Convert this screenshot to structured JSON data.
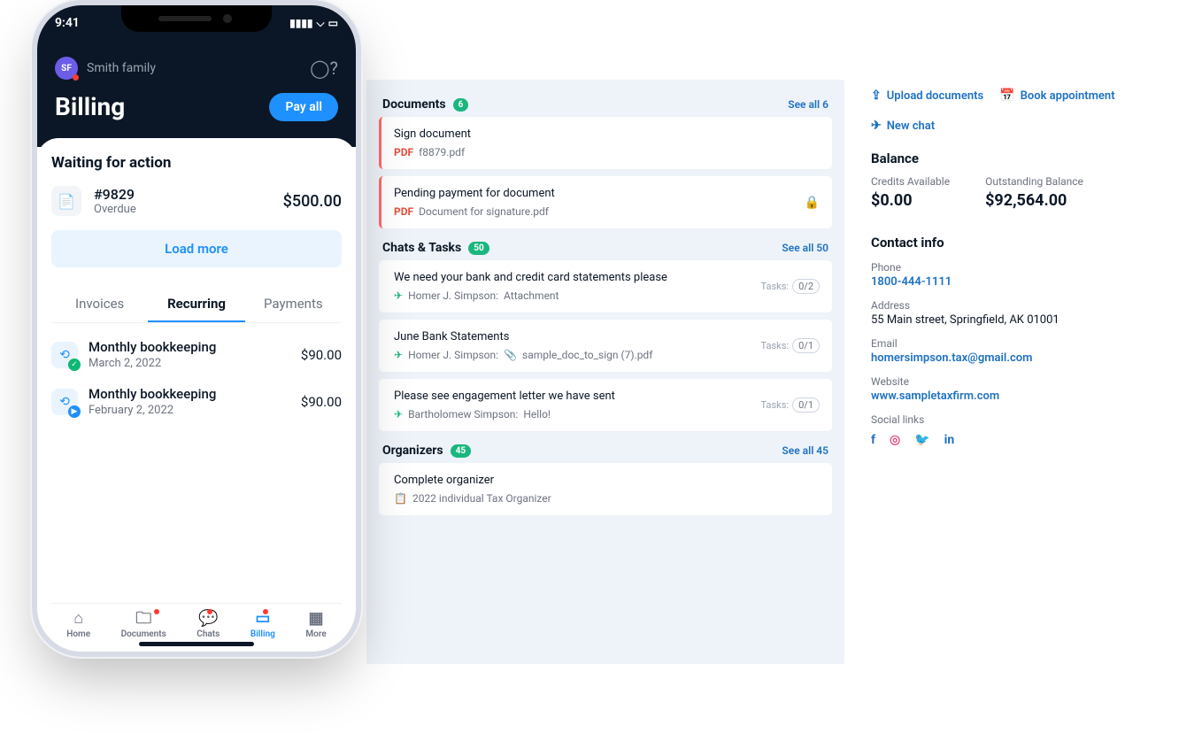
{
  "phone": {
    "status_time": "9:41",
    "avatar_initials": "SF",
    "user_name": "Smith family",
    "page_title": "Billing",
    "pay_all": "Pay all",
    "waiting_header": "Waiting for action",
    "invoice": {
      "id": "#9829",
      "status": "Overdue",
      "amount": "$500.00"
    },
    "load_more": "Load more",
    "tabs": {
      "invoices": "Invoices",
      "recurring": "Recurring",
      "payments": "Payments"
    },
    "recurring": [
      {
        "title": "Monthly bookkeeping",
        "date": "March 2, 2022",
        "amount": "$90.00"
      },
      {
        "title": "Monthly bookkeeping",
        "date": "February 2, 2022",
        "amount": "$90.00"
      }
    ],
    "tabbar": {
      "home": "Home",
      "documents": "Documents",
      "chats": "Chats",
      "billing": "Billing",
      "more": "More"
    }
  },
  "documents": {
    "header": "Documents",
    "count": "6",
    "see_all": "See all 6",
    "items": [
      {
        "title": "Sign document",
        "file": "f8879.pdf"
      },
      {
        "title": "Pending payment for document",
        "file": "Document for signature.pdf"
      }
    ]
  },
  "chats": {
    "header": "Chats & Tasks",
    "count": "50",
    "see_all": "See all 50",
    "items": [
      {
        "title": "We need your bank and credit card statements please",
        "author": "Homer J. Simpson:",
        "extra": "Attachment",
        "tasks_label": "Tasks:",
        "tasks": "0/2"
      },
      {
        "title": "June Bank Statements",
        "author": "Homer J. Simpson:",
        "extra": "sample_doc_to_sign (7).pdf",
        "has_clip": true,
        "tasks_label": "Tasks:",
        "tasks": "0/1"
      },
      {
        "title": "Please see engagement letter we have sent",
        "author": "Bartholomew Simpson:",
        "extra": "Hello!",
        "tasks_label": "Tasks:",
        "tasks": "0/1"
      }
    ]
  },
  "organizers": {
    "header": "Organizers",
    "count": "45",
    "see_all": "See all 45",
    "item": {
      "title": "Complete organizer",
      "sub": "2022 individual Tax Organizer"
    }
  },
  "actions": {
    "upload": "Upload documents",
    "book": "Book appointment",
    "newchat": "New chat"
  },
  "balance": {
    "header": "Balance",
    "credits_label": "Credits Available",
    "credits_value": "$0.00",
    "outstanding_label": "Outstanding Balance",
    "outstanding_value": "$92,564.00"
  },
  "contact": {
    "header": "Contact info",
    "phone_lbl": "Phone",
    "phone": "1800-444-1111",
    "address_lbl": "Address",
    "address": "55 Main street, Springfield, AK 01001",
    "email_lbl": "Email",
    "email": "homersimpson.tax@gmail.com",
    "website_lbl": "Website",
    "website": "www.sampletaxfirm.com",
    "social_lbl": "Social links"
  }
}
